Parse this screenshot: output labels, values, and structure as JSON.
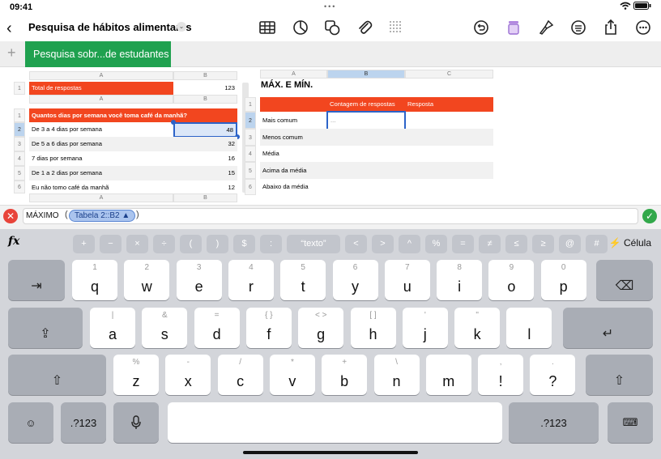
{
  "status": {
    "time": "09:41",
    "dots": "•••",
    "battery": "▮▮▮"
  },
  "doc": {
    "title": "Pesquisa de hábitos alimentares",
    "chevron": "⌄"
  },
  "toolbar_icons": [
    "table-icon",
    "chart-icon",
    "shapes-icon",
    "paperclip-icon",
    "grid-icon",
    "undo-icon",
    "tumbler-icon",
    "brush-icon",
    "format-icon",
    "share-icon",
    "more-icon"
  ],
  "sheet": {
    "add": "+",
    "tab_label": "Pesquisa sobr...de estudantes"
  },
  "table1": {
    "col_a": "A",
    "col_b": "B",
    "row1": "1",
    "label": "Total de respostas",
    "value": "123"
  },
  "table2": {
    "col_a": "A",
    "col_b": "B",
    "header": "Quantos dias por semana você toma café da manhã?",
    "rows": [
      {
        "n": "2",
        "label": "De 3 a 4 dias por semana",
        "value": "48"
      },
      {
        "n": "3",
        "label": "De 5 a 6 dias por semana",
        "value": "32"
      },
      {
        "n": "4",
        "label": "7 dias por semana",
        "value": "16"
      },
      {
        "n": "5",
        "label": "De 1 a 2 dias por semana",
        "value": "15"
      },
      {
        "n": "6",
        "label": "Eu não tomo café da manhã",
        "value": "12"
      }
    ],
    "row1": "1"
  },
  "table3": {
    "title": "MÁX. E MÍN.",
    "col_a": "A",
    "col_b": "B",
    "col_c": "C",
    "hdr_b": "Contagem de respostas",
    "hdr_c": "Resposta",
    "rows": [
      {
        "n": "2",
        "label": "Mais comum",
        "value": "..."
      },
      {
        "n": "3",
        "label": "Menos comum",
        "value": ""
      },
      {
        "n": "4",
        "label": "Média",
        "value": ""
      },
      {
        "n": "5",
        "label": "Acima da média",
        "value": ""
      },
      {
        "n": "6",
        "label": "Abaixo da média",
        "value": ""
      }
    ],
    "row1": "1"
  },
  "formula": {
    "close": "✕",
    "ok": "✓",
    "function": "MÁXIMO",
    "open_paren": "(",
    "chip": "Tabela 2::B2 ▲",
    "close_paren": ")"
  },
  "keyboard": {
    "fx": "fx",
    "func_keys": [
      "+",
      "−",
      "×",
      "÷",
      "(",
      ")",
      "$",
      ":",
      "“texto”",
      "<",
      ">",
      "^",
      "%",
      "=",
      "≠",
      "≤",
      "≥",
      "@",
      "#"
    ],
    "cell_label": "⚡ Célula",
    "row1": [
      {
        "sec": "1",
        "pri": "q"
      },
      {
        "sec": "2",
        "pri": "w"
      },
      {
        "sec": "3",
        "pri": "e"
      },
      {
        "sec": "4",
        "pri": "r"
      },
      {
        "sec": "5",
        "pri": "t"
      },
      {
        "sec": "6",
        "pri": "y"
      },
      {
        "sec": "7",
        "pri": "u"
      },
      {
        "sec": "8",
        "pri": "i"
      },
      {
        "sec": "9",
        "pri": "o"
      },
      {
        "sec": "0",
        "pri": "p"
      }
    ],
    "row2": [
      {
        "sec": "|",
        "pri": "a"
      },
      {
        "sec": "&",
        "pri": "s"
      },
      {
        "sec": "=",
        "pri": "d"
      },
      {
        "sec": "{ }",
        "pri": "f"
      },
      {
        "sec": "< >",
        "pri": "g"
      },
      {
        "sec": "[ ]",
        "pri": "h"
      },
      {
        "sec": "'",
        "pri": "j"
      },
      {
        "sec": "\"",
        "pri": "k"
      },
      {
        "sec": "",
        "pri": "l"
      }
    ],
    "row3": [
      {
        "sec": "%",
        "pri": "z"
      },
      {
        "sec": "-",
        "pri": "x"
      },
      {
        "sec": "/",
        "pri": "c"
      },
      {
        "sec": "*",
        "pri": "v"
      },
      {
        "sec": "+",
        "pri": "b"
      },
      {
        "sec": "\\",
        "pri": "n"
      },
      {
        "sec": "",
        "pri": "m"
      },
      {
        "sec": "",
        "pri": "!"
      },
      {
        "sec": "",
        "pri": "?"
      }
    ],
    "row3_marks": {
      "excl_sec": ",",
      "ques_sec": "."
    },
    "tab": "⇥",
    "delete": "⌫",
    "caps": "⇪",
    "return": "↵",
    "shift": "⇧",
    "emoji": "☺",
    "numbers": ".?123",
    "mic": "🎤",
    "hide": "⌨"
  }
}
